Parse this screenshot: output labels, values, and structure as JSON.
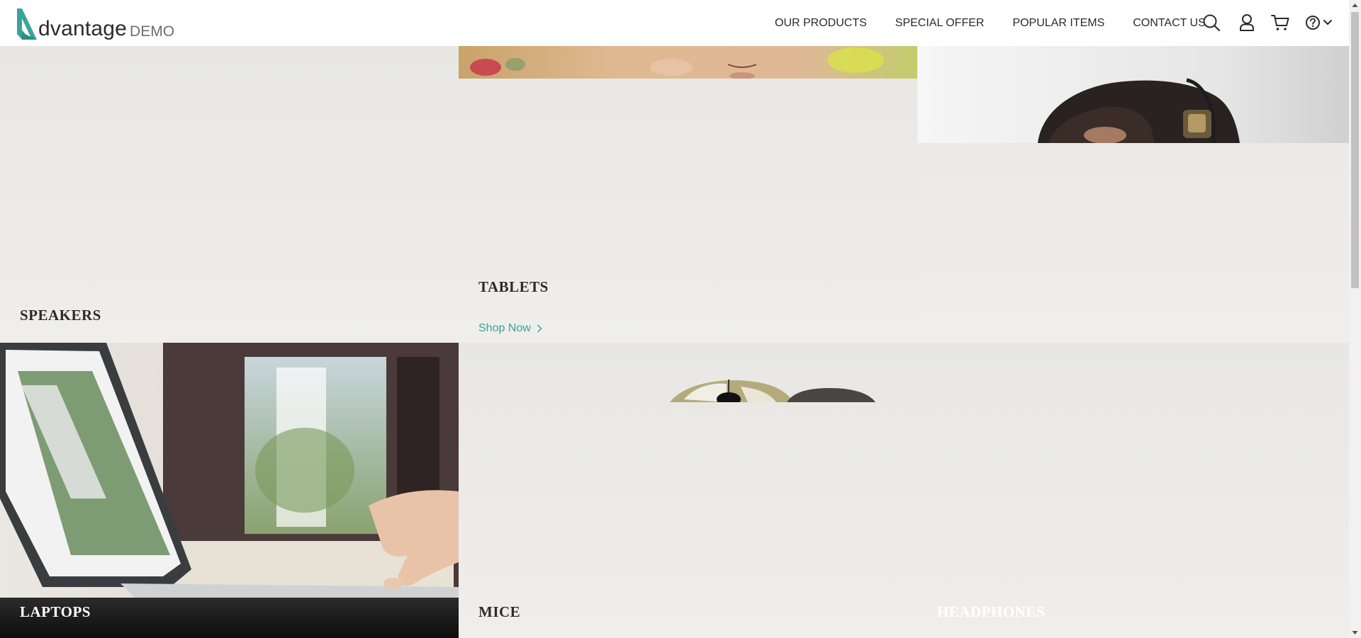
{
  "header": {
    "logo": {
      "brand": "dvantage",
      "suffix": "DEMO"
    },
    "nav": [
      {
        "label": "OUR PRODUCTS"
      },
      {
        "label": "SPECIAL OFFER"
      },
      {
        "label": "POPULAR ITEMS"
      },
      {
        "label": "CONTACT US"
      }
    ],
    "icons": [
      "search-icon",
      "user-icon",
      "cart-icon",
      "help-icon",
      "chevron-down-icon"
    ]
  },
  "categories": {
    "speakers": {
      "title": "SPEAKERS"
    },
    "tablets": {
      "title": "TABLETS",
      "cta": "Shop Now"
    },
    "laptops": {
      "title": "LAPTOPS"
    },
    "mice": {
      "title": "MICE"
    },
    "headphones": {
      "title": "HEADPHONES"
    }
  },
  "colors": {
    "accent": "#3aa39c",
    "tile_background": "#ebeae6",
    "text": "#2b2b2b"
  }
}
